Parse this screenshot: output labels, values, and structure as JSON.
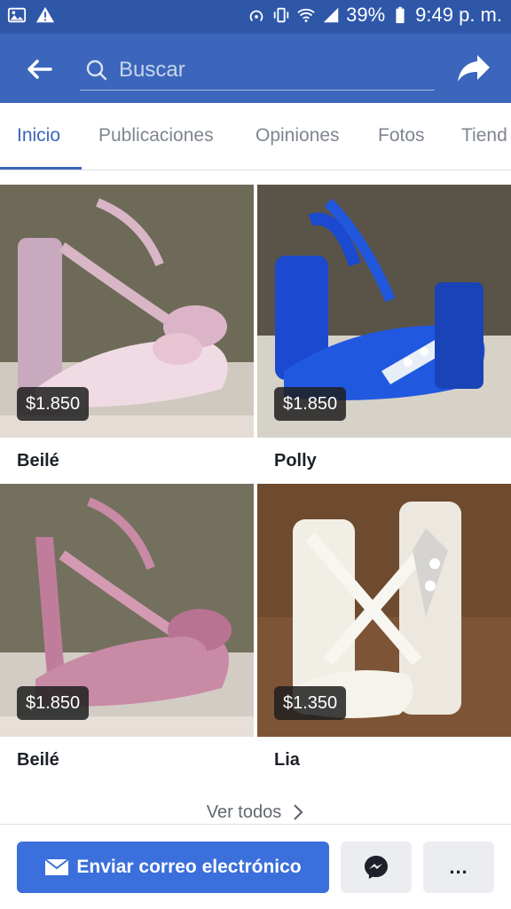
{
  "status_bar": {
    "icons_left": [
      "image-icon",
      "warning-icon"
    ],
    "icons_right": [
      "hotspot-icon",
      "vibrate-icon",
      "wifi-icon",
      "signal-icon",
      "battery-icon"
    ],
    "battery": "39%",
    "time": "9:49 p. m."
  },
  "app_bar": {
    "back_icon": "arrow-left-icon",
    "search_placeholder": "Buscar",
    "share_icon": "share-icon"
  },
  "tabs": [
    {
      "label": "Inicio",
      "active": true
    },
    {
      "label": "Publicaciones",
      "active": false
    },
    {
      "label": "Opiniones",
      "active": false
    },
    {
      "label": "Fotos",
      "active": false
    },
    {
      "label": "Tiend",
      "active": false
    }
  ],
  "products": [
    {
      "name": "Beilé",
      "price": "$1.850",
      "color": "#d9b8c9"
    },
    {
      "name": "Polly",
      "price": "$1.850",
      "color": "#1d4fd6"
    },
    {
      "name": "Beilé",
      "price": "$1.850",
      "color": "#c98aa6"
    },
    {
      "name": "Lia",
      "price": "$1.350",
      "color": "#efece4"
    }
  ],
  "see_all": {
    "label": "Ver todos"
  },
  "actions": {
    "email_label": "Enviar correo electrónico",
    "more_label": "..."
  },
  "colors": {
    "accent": "#3b66bb",
    "status_bar": "#2e57a8",
    "button": "#3b6fdb"
  }
}
